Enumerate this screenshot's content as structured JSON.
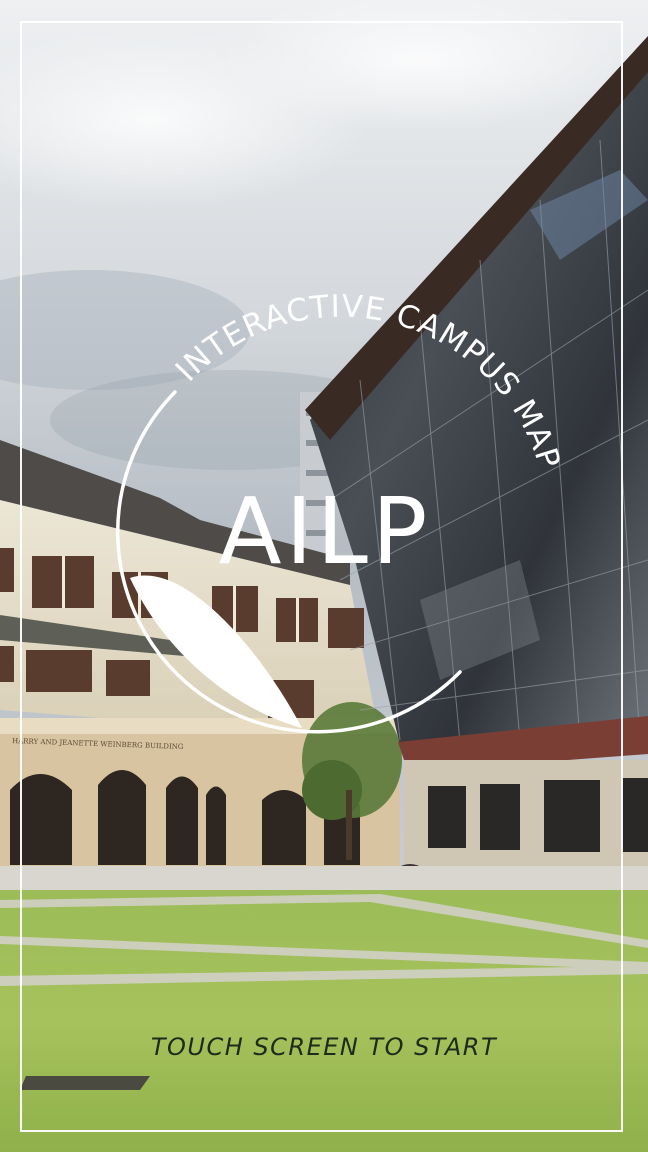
{
  "logo": {
    "wordmark": "AILP",
    "arc_text": "INTERACTIVE CAMPUS MAP"
  },
  "building_sign": "HARRY AND JEANETTE WEINBERG BUILDING",
  "cta": "TOUCH SCREEN TO START",
  "icons": [
    "leaf-logo-icon"
  ],
  "colors": {
    "frame": "#ffffff",
    "logo": "#ffffff",
    "cta_text": "#1e2a1a",
    "sky": "#d6dade",
    "lawn": "#9cbb55"
  }
}
